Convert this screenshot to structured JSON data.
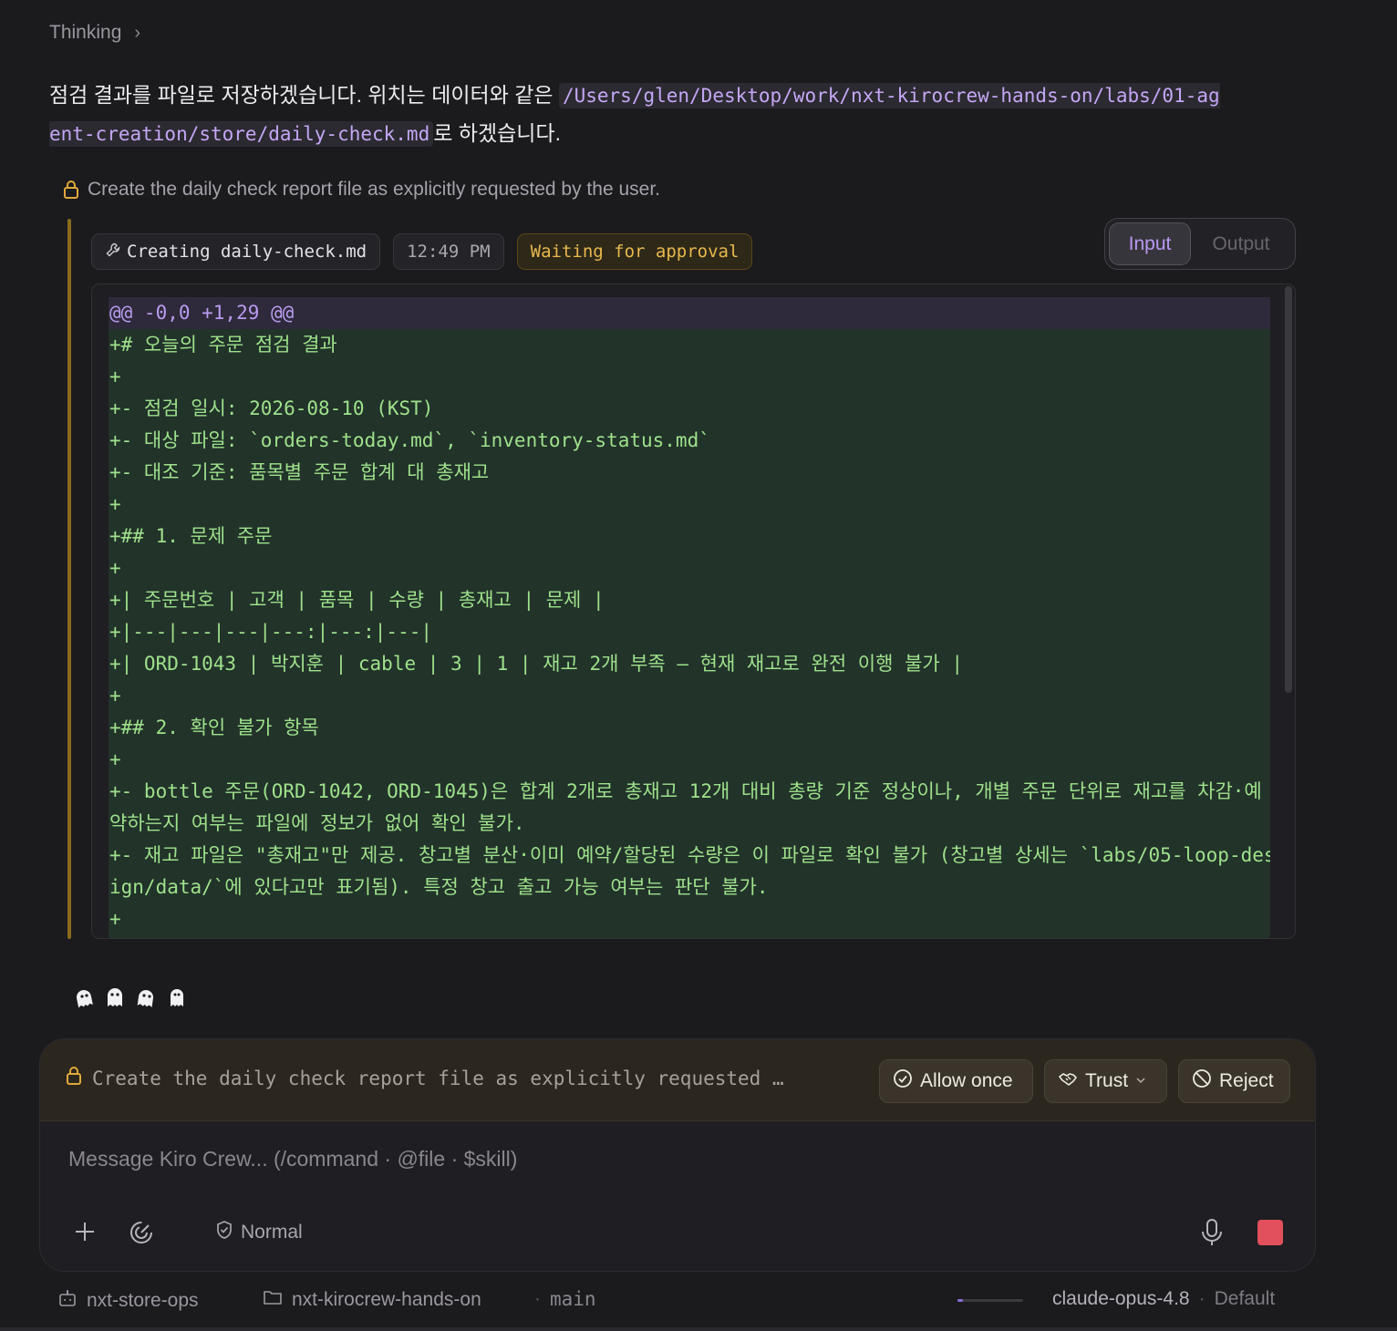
{
  "thinking_label": "Thinking",
  "intro": {
    "before": "점검 결과를 파일로 저장하겠습니다. 위치는 데이터와 같은 ",
    "path_line1": "/Users/glen/Desktop/work/nxt-kirocrew-hands-on/labs/01-ag",
    "path_line2": "ent-creation/store/daily-check.md",
    "after": "로 하겠습니다."
  },
  "tool_description": "Create the daily check report file as explicitly requested by the user.",
  "tool_chip": "Creating daily-check.md",
  "time_chip": "12:49 PM",
  "status_chip": "Waiting for approval",
  "tabs": {
    "input": "Input",
    "output": "Output"
  },
  "diff": {
    "hunk": "@@ -0,0 +1,29 @@",
    "lines": [
      "+# 오늘의 주문 점검 결과",
      "+",
      "+- 점검 일시: 2026-08-10 (KST)",
      "+- 대상 파일: `orders-today.md`, `inventory-status.md`",
      "+- 대조 기준: 품목별 주문 합계 대 총재고",
      "+",
      "+## 1. 문제 주문",
      "+",
      "+| 주문번호 | 고객 | 품목 | 수량 | 총재고 | 문제 |",
      "+|---|---|---|---:|---:|---|",
      "+| ORD-1043 | 박지훈 | cable | 3 | 1 | 재고 2개 부족 — 현재 재고로 완전 이행 불가 |",
      "+",
      "+## 2. 확인 불가 항목",
      "+",
      "+- bottle 주문(ORD-1042, ORD-1045)은 합계 2개로 총재고 12개 대비 총량 기준 정상이나, 개별 주문 단위로 재고를 차감·예",
      "약하는지 여부는 파일에 정보가 없어 확인 불가.",
      "+- 재고 파일은 \"총재고\"만 제공. 창고별 분산·이미 예약/할당된 수량은 이 파일로 확인 불가 (창고별 상세는 `labs/05-loop-des",
      "ign/data/`에 있다고만 표기됨). 특정 창고 출고 가능 여부는 판단 불가.",
      "+"
    ]
  },
  "approval": {
    "text": "Create the daily check report file as explicitly requested …",
    "allow_once": "Allow once",
    "trust": "Trust",
    "reject": "Reject"
  },
  "composer": {
    "placeholder": "Message Kiro Crew... (/command · @file · $skill)",
    "mode": "Normal"
  },
  "status_bar": {
    "agent": "nxt-store-ops",
    "folder": "nxt-kirocrew-hands-on",
    "branch": "main",
    "model": "claude-opus-4.8",
    "profile": "Default",
    "context_usage_fraction": 0.08
  }
}
